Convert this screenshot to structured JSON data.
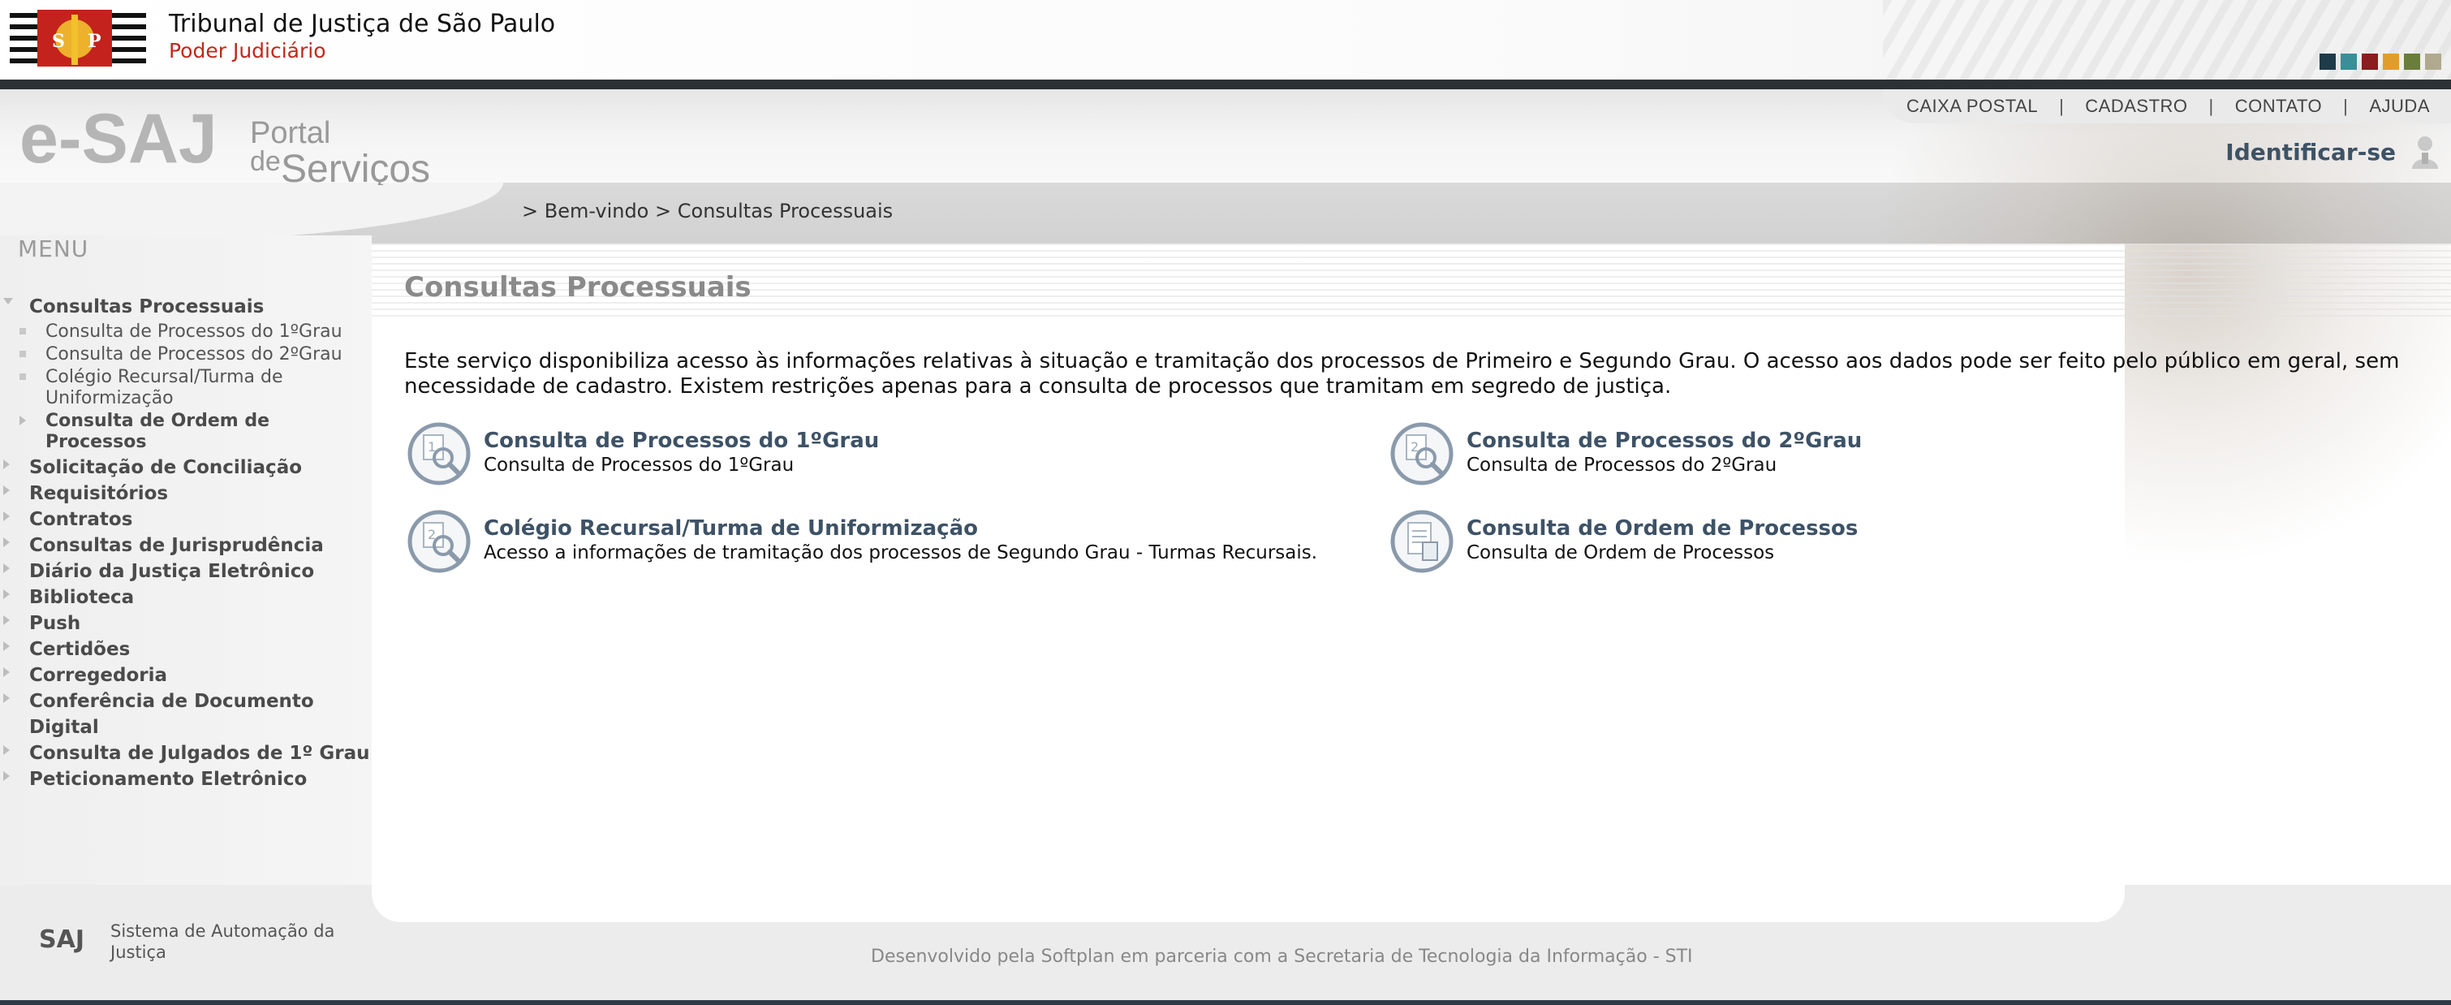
{
  "header": {
    "tribunal_name": "Tribunal de Justiça de São Paulo",
    "tribunal_sub": "Poder Judiciário",
    "swatch_colors": [
      "#1e3b4a",
      "#3a8e98",
      "#8a1d1d",
      "#e19d2a",
      "#6b7d3a",
      "#b1a98e"
    ],
    "top_links": [
      "CAIXA POSTAL",
      "CADASTRO",
      "CONTATO",
      "AJUDA"
    ],
    "separator": "|",
    "login_label": "Identificar-se",
    "breadcrumb": [
      "> Bem-vindo",
      "> Consultas Processuais"
    ]
  },
  "logo": {
    "esaj": "e-SAJ",
    "portal": "Portal",
    "de": "de",
    "servicos": "Serviços"
  },
  "sidebar": {
    "menu_title": "MENU",
    "open_section": "Consultas Processuais",
    "sub_items": [
      "Consulta de Processos do 1ºGrau",
      "Consulta de Processos do 2ºGrau",
      "Colégio Recursal/Turma de Uniformização",
      "Consulta de Ordem de Processos"
    ],
    "items": [
      "Solicitação de Conciliação",
      "Requisitórios",
      "Contratos",
      "Consultas de Jurisprudência",
      "Diário da Justiça Eletrônico",
      "Biblioteca",
      "Push",
      "Certidões",
      "Corregedoria",
      "Conferência de Documento Digital",
      "Consulta de Julgados de 1º Grau",
      "Peticionamento Eletrônico"
    ]
  },
  "main": {
    "title": "Consultas Processuais",
    "intro": "Este serviço disponibiliza acesso às informações relativas à situação e tramitação dos processos de Primeiro e Segundo Grau. O acesso aos dados pode ser feito pelo público em geral, sem necessidade de cadastro. Existem restrições apenas para a consulta de processos que tramitam em segredo de justiça.",
    "services": [
      {
        "title": "Consulta de Processos do 1ºGrau",
        "desc": "Consulta de Processos do 1ºGrau",
        "icon": "magnifier-doc-1-icon"
      },
      {
        "title": "Consulta de Processos do 2ºGrau",
        "desc": "Consulta de Processos do 2ºGrau",
        "icon": "magnifier-doc-2-icon"
      },
      {
        "title": "Colégio Recursal/Turma de Uniformização",
        "desc": "Acesso a informações de tramitação dos processos de Segundo Grau - Turmas Recursais.",
        "icon": "magnifier-doc-2-icon"
      },
      {
        "title": "Consulta de Ordem de Processos",
        "desc": "Consulta de Ordem de Processos",
        "icon": "document-list-icon"
      }
    ]
  },
  "footer": {
    "saj_logo": "SAJ",
    "saj_desc": "Sistema de Automação da Justiça",
    "credit": "Desenvolvido pela Softplan em parceria com a Secretaria de Tecnologia da Informação - STI"
  }
}
